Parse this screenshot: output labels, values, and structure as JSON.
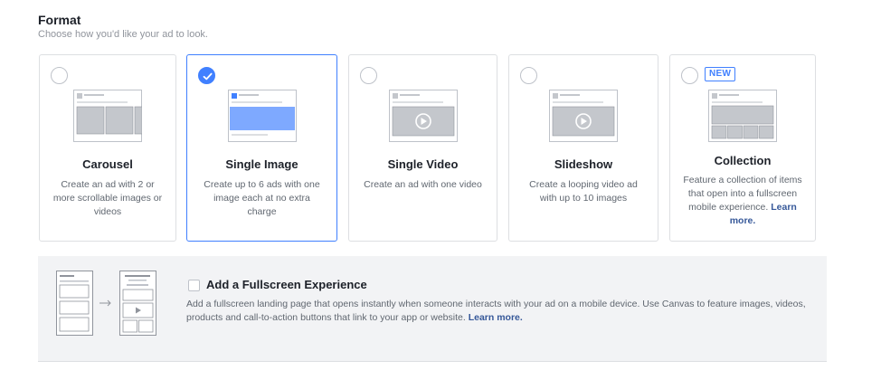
{
  "format": {
    "title": "Format",
    "subtitle": "Choose how you'd like your ad to look."
  },
  "cards": [
    {
      "name": "Carousel",
      "desc": "Create an ad with 2 or more scrollable images or videos",
      "selected": false
    },
    {
      "name": "Single Image",
      "desc": "Create up to 6 ads with one image each at no extra charge",
      "selected": true
    },
    {
      "name": "Single Video",
      "desc": "Create an ad with one video",
      "selected": false
    },
    {
      "name": "Slideshow",
      "desc": "Create a looping video ad with up to 10 images",
      "selected": false
    },
    {
      "name": "Collection",
      "desc": "Feature a collection of items that open into a fullscreen mobile experience.",
      "link": "Learn more.",
      "badge": "NEW",
      "selected": false
    }
  ],
  "fullscreen": {
    "title": "Add a Fullscreen Experience",
    "desc": "Add a fullscreen landing page that opens instantly when someone interacts with your ad on a mobile device. Use Canvas to feature images, videos, products and call-to-action buttons that link to your app or website.",
    "link": "Learn more.",
    "checked": false
  },
  "colors": {
    "accent": "#4080ff",
    "link": "#365899",
    "placeholder": "#c4c7cc"
  }
}
